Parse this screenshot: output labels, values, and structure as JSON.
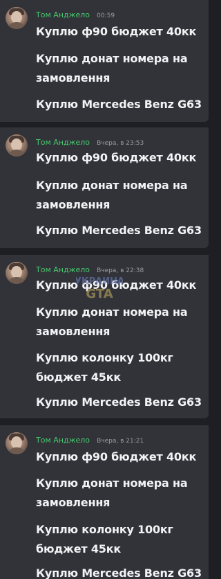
{
  "messages": [
    {
      "username": "Том Анджело",
      "timestamp": "00:59",
      "lines": [
        "Куплю ф90 бюджет 40кк",
        "Куплю донат номера на замовлення",
        "Куплю Mercedes Benz G63"
      ]
    },
    {
      "username": "Том Анджело",
      "timestamp": "Вчера, в 23:53",
      "lines": [
        "Куплю ф90 бюджет 40кк",
        "Куплю донат номера на замовлення",
        "Куплю Mercedes Benz G63"
      ]
    },
    {
      "username": "Том Анджело",
      "timestamp": "Вчера, в 22:38",
      "lines": [
        "Куплю ф90 бюджет 40кк",
        "Куплю донат номера на замовлення",
        "Куплю колонку 100кг бюджет 45кк",
        "Куплю Mercedes Benz G63"
      ]
    },
    {
      "username": "Том Анджело",
      "timestamp": "Вчера, в 21:21",
      "lines": [
        "Куплю ф90 бюджет 40кк",
        "Куплю донат номера на замовлення",
        "Куплю колонку 100кг бюджет 45кк",
        "Куплю Mercedes Benz G63"
      ]
    }
  ],
  "watermark": {
    "line1": "УКРАИНА",
    "line2": "GTA"
  },
  "colors": {
    "username": "#47c96e",
    "message_bg": "#313338",
    "page_bg": "#1e1f22",
    "text": "#f2f3f5",
    "timestamp": "#9a9ca3"
  }
}
